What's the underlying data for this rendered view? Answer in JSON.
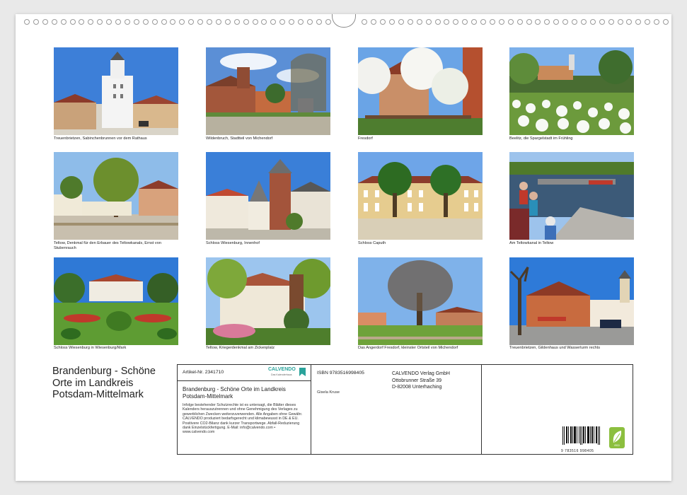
{
  "photos": [
    {
      "caption": "Treuenbrietzen, Sabinchenbrunnen vor dem Rathaus"
    },
    {
      "caption": "Wildenbruch, Stadtteil von Michendorf"
    },
    {
      "caption": "Fresdorf"
    },
    {
      "caption": "Beelitz, die Spargelstadt im Frühling"
    },
    {
      "caption": "Teltow, Denkmal für den Erbauer des Teltowkanals, Ernst von Stubenrauch"
    },
    {
      "caption": "Schloss Wiesenburg, Innenhof"
    },
    {
      "caption": "Schloss Caputh"
    },
    {
      "caption": "Am Teltowkanal in Teltow"
    },
    {
      "caption": "Schloss Wiesenburg in Wiesenburg/Mark"
    },
    {
      "caption": "Teltow, Kriegerdenkmal am Zickenplatz"
    },
    {
      "caption": "Das Angerdorf Fresdorf, kleinster Ortsteil von Michendorf"
    },
    {
      "caption": "Treuenbrietzen, Gildenhaus und Wasserturm rechts"
    }
  ],
  "title": "Brandenburg - Schöne Orte im Landkreis Potsdam-Mittelmark",
  "info": {
    "article_no": "Artikel-Nr. 2341710",
    "calvendo_logo": "CALVENDO",
    "calvendo_sub": "Das Kalenderhaus",
    "calendar_title": "Brandenburg - Schöne Orte im Landkreis Potsdam-Mittelmark",
    "legal_text": "Infolge bestehender Schutzrechte ist es untersagt, die Blätter dieses Kalenders herauszutrennen und ohne Genehmigung des Verlages zu gewerblichen Zwecken weiterzuverwenden. Alle Angaben ohne Gewähr. CALVENDO produziert bedarfsgerecht und klimabewusst in DE & EU. Positivere CO2-Bilanz dank kurzer Transportwege. Abfall-Reduzierung dank Einzelstückfertigung. E-Mail: info@calvendo.com • www.calvendo.com",
    "isbn": "ISBN 9783516998405",
    "author": "Gisela Kruse",
    "publisher_line1": "CALVENDO Verlag GmbH",
    "publisher_line2": "Ottobrunner Straße 39",
    "publisher_line3": "D-82008 Unterhaching",
    "barcode_digits": "9 783516 998405",
    "eco_label": "eco"
  },
  "colors": {
    "accent_teal": "#2aa39b",
    "eco_green": "#8cbf3f"
  }
}
